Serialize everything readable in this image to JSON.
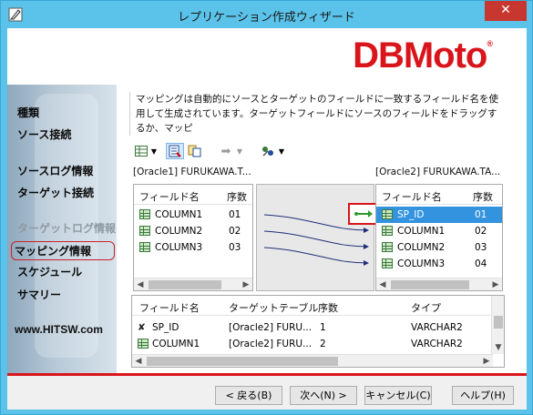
{
  "window": {
    "title": "レプリケーション作成ウィザード",
    "close_label": "✕",
    "icon": "wizard-pencil-icon"
  },
  "banner": {
    "logo_text": "DBMoto",
    "logo_mark": "®",
    "accent_color": "#d9141b"
  },
  "sidebar": {
    "items": [
      {
        "label": "種類",
        "state": "normal"
      },
      {
        "label": "ソース接続",
        "state": "normal"
      },
      {
        "label": "ソースログ情報",
        "state": "normal"
      },
      {
        "label": "ターゲット接続",
        "state": "normal"
      },
      {
        "label": "ターゲットログ情報",
        "state": "disabled"
      },
      {
        "label": "マッピング情報",
        "state": "active"
      },
      {
        "label": "スケジュール",
        "state": "normal"
      },
      {
        "label": "サマリー",
        "state": "normal"
      }
    ],
    "website": "www.HITSW.com"
  },
  "description": {
    "text": "マッピングは自動的にソースとターゲットのフィールドに一致するフィールド名を使用して生成されています。ターゲットフィールドにソースのフィールドをドラッグするか、マッピ"
  },
  "toolbar": {
    "icons": [
      "grid-view-icon",
      "dropdown-arrow-icon",
      "auto-map-icon",
      "copy-mapping-icon",
      "map-arrow-icon",
      "dropdown-arrow-icon",
      "script-icon",
      "dropdown-arrow-icon"
    ]
  },
  "source": {
    "label": "[Oracle1] FURUKAWA.T...",
    "col_name": "フィールド名",
    "col_order": "序数",
    "rows": [
      {
        "name": "COLUMN1",
        "order": "01"
      },
      {
        "name": "COLUMN2",
        "order": "02"
      },
      {
        "name": "COLUMN3",
        "order": "03"
      }
    ]
  },
  "target": {
    "label": "[Oracle2] FURUKAWA.TA...",
    "col_name": "フィールド名",
    "col_order": "序数",
    "rows": [
      {
        "name": "SP_ID",
        "order": "01",
        "selected": true
      },
      {
        "name": "COLUMN1",
        "order": "02"
      },
      {
        "name": "COLUMN2",
        "order": "03"
      },
      {
        "name": "COLUMN3",
        "order": "04"
      }
    ]
  },
  "details": {
    "headers": {
      "field": "フィールド名",
      "target_table": "ターゲットテーブル",
      "order": "序数",
      "type": "タイプ"
    },
    "rows": [
      {
        "field": "SP_ID",
        "target_table": "[Oracle2] FURU...",
        "order": "1",
        "type": "VARCHAR2"
      },
      {
        "field": "COLUMN1",
        "target_table": "[Oracle2] FURU...",
        "order": "2",
        "type": "VARCHAR2"
      }
    ]
  },
  "buttons": {
    "back": "< 戻る(B)",
    "next": "次へ(N) >",
    "cancel": "キャンセル(C)",
    "help": "ヘルプ(H)"
  }
}
